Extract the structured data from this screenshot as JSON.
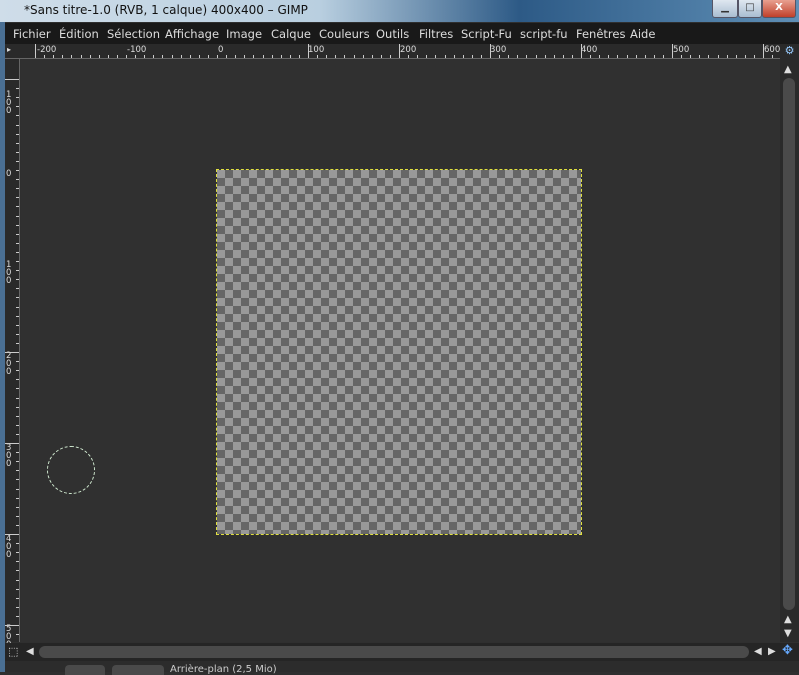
{
  "window": {
    "title": "*Sans titre-1.0 (RVB, 1 calque) 400x400 – GIMP",
    "minimize": "▁",
    "maximize": "□",
    "close": "X"
  },
  "menu": [
    {
      "label": "Fichier"
    },
    {
      "label": "Édition"
    },
    {
      "label": "Sélection"
    },
    {
      "label": "Affichage"
    },
    {
      "label": "Image"
    },
    {
      "label": "Calque"
    },
    {
      "label": "Couleurs"
    },
    {
      "label": "Outils"
    },
    {
      "label": "Filtres"
    },
    {
      "label": "Script-Fu"
    },
    {
      "label": "script-fu"
    },
    {
      "label": "Fenêtres"
    },
    {
      "label": "Aide"
    }
  ],
  "hruler": [
    "-200",
    "-100",
    "0",
    "100",
    "200",
    "300",
    "400",
    "500",
    "600"
  ],
  "vruler": [
    "100",
    "0",
    "100",
    "200",
    "300",
    "400",
    "500"
  ],
  "canvas": {
    "width": 400,
    "height": 400,
    "background": "transparent"
  },
  "status": {
    "text": "Arrière-plan (2,5 Mio)"
  },
  "colors": {
    "selection": "#e0e040",
    "workspace": "#303030"
  }
}
